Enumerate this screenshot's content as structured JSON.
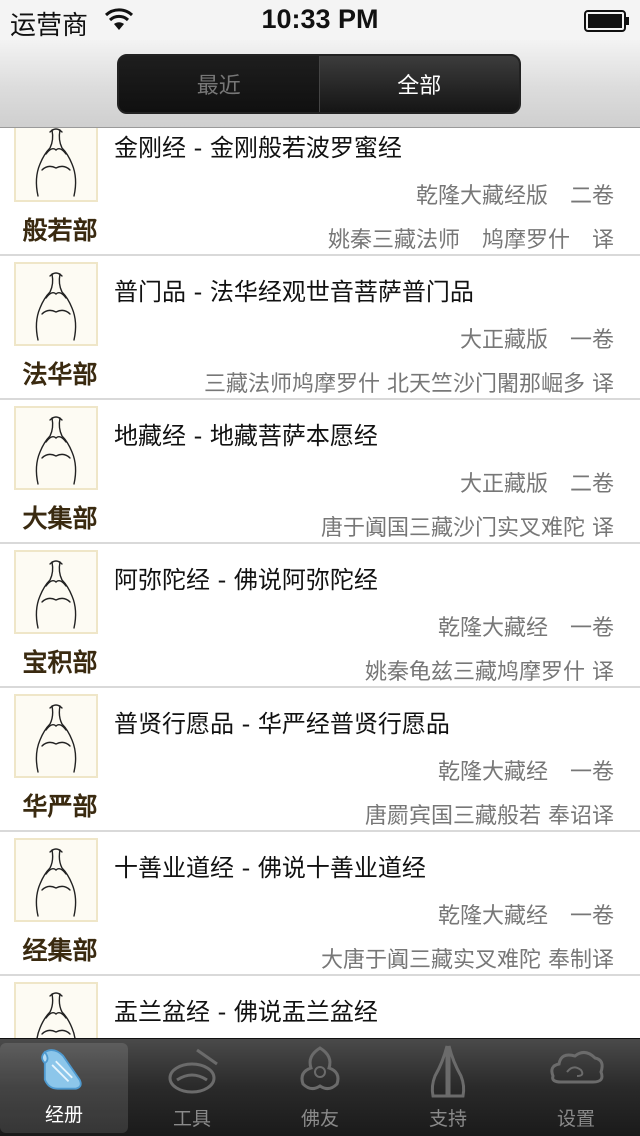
{
  "status_bar": {
    "carrier": "运营商",
    "time": "10:33 PM"
  },
  "segmented": {
    "recent_label": "最近",
    "all_label": "全部",
    "selected": "全部"
  },
  "sutras": [
    {
      "title": "金刚经 - 金刚般若波罗蜜经",
      "version": "乾隆大藏经版　二卷",
      "translator": "姚秦三藏法师　鸠摩罗什　译",
      "category": "般若部",
      "icon": "mudra-hands-icon"
    },
    {
      "title": "普门品 - 法华经观世音菩萨普门品",
      "version": "大正藏版　一卷",
      "translator": "三藏法师鸠摩罗什 北天竺沙门闍那崛多 译",
      "category": "法华部",
      "icon": "mudra-hands-icon"
    },
    {
      "title": "地藏经 - 地藏菩萨本愿经",
      "version": "大正藏版　二卷",
      "translator": "唐于阗国三藏沙门实叉难陀 译",
      "category": "大集部",
      "icon": "mudra-hands-icon"
    },
    {
      "title": "阿弥陀经 - 佛说阿弥陀经",
      "version": "乾隆大藏经　一卷",
      "translator": "姚秦龟兹三藏鸠摩罗什 译",
      "category": "宝积部",
      "icon": "mudra-hands-icon"
    },
    {
      "title": "普贤行愿品 - 华严经普贤行愿品",
      "version": "乾隆大藏经　一卷",
      "translator": "唐罽宾国三藏般若 奉诏译",
      "category": "华严部",
      "icon": "mudra-hands-icon"
    },
    {
      "title": "十善业道经 - 佛说十善业道经",
      "version": "乾隆大藏经　一卷",
      "translator": "大唐于阗三藏实叉难陀 奉制译",
      "category": "经集部",
      "icon": "mudra-hands-icon"
    },
    {
      "title": "盂兰盆经 - 佛说盂兰盆经",
      "version": "",
      "translator": "",
      "category": "",
      "icon": "mudra-hands-icon"
    }
  ],
  "tabs": [
    {
      "label": "经册",
      "icon": "scroll-icon",
      "active": true
    },
    {
      "label": "工具",
      "icon": "bell-tool-icon",
      "active": false
    },
    {
      "label": "佛友",
      "icon": "ornament-icon",
      "active": false
    },
    {
      "label": "支持",
      "icon": "praying-hands-icon",
      "active": false
    },
    {
      "label": "设置",
      "icon": "cloud-settings-icon",
      "active": false
    }
  ],
  "colors": {
    "category_text": "#3a2a10",
    "secondary_text": "#777777",
    "tab_bar": "#2a2a2a",
    "active_tab_icon": "#6fb3e0"
  }
}
